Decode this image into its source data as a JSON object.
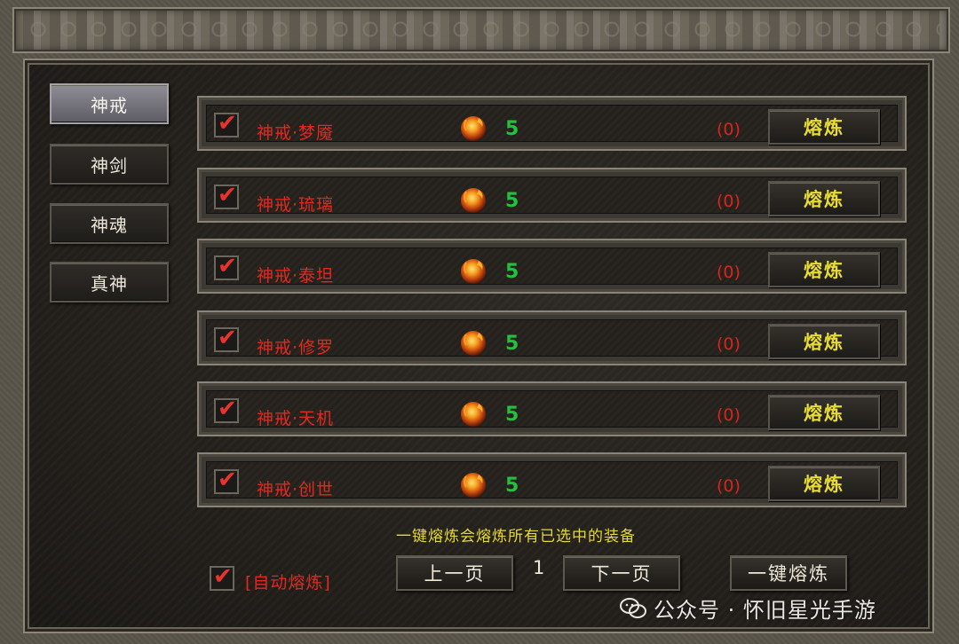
{
  "tabs": [
    {
      "label": "神戒",
      "active": true
    },
    {
      "label": "神剑",
      "active": false
    },
    {
      "label": "神魂",
      "active": false
    },
    {
      "label": "真神",
      "active": false
    }
  ],
  "items": [
    {
      "name": "神戒·梦魇",
      "checked": true,
      "count": "5",
      "owned": "(0)",
      "button": "熔炼"
    },
    {
      "name": "神戒·琉璃",
      "checked": true,
      "count": "5",
      "owned": "(0)",
      "button": "熔炼"
    },
    {
      "name": "神戒·泰坦",
      "checked": true,
      "count": "5",
      "owned": "(0)",
      "button": "熔炼"
    },
    {
      "name": "神戒·修罗",
      "checked": true,
      "count": "5",
      "owned": "(0)",
      "button": "熔炼"
    },
    {
      "name": "神戒·天机",
      "checked": true,
      "count": "5",
      "owned": "(0)",
      "button": "熔炼"
    },
    {
      "name": "神戒·创世",
      "checked": true,
      "count": "5",
      "owned": "(0)",
      "button": "熔炼"
    }
  ],
  "hint": "一键熔炼会熔炼所有已选中的装备",
  "auto_smelt": {
    "label": "[自动熔炼]",
    "checked": true
  },
  "pagination": {
    "prev": "上一页",
    "page": "1",
    "next": "下一页"
  },
  "one_click": "一键熔炼",
  "watermark": "公众号 · 怀旧星光手游",
  "icons": {
    "material": "fire-orb-icon",
    "check": "checkmark-icon",
    "wechat": "wechat-icon"
  },
  "colors": {
    "item_name": "#e02a20",
    "count": "#21c23d",
    "button_text": "#e8dc33",
    "hint": "#e6d835"
  }
}
